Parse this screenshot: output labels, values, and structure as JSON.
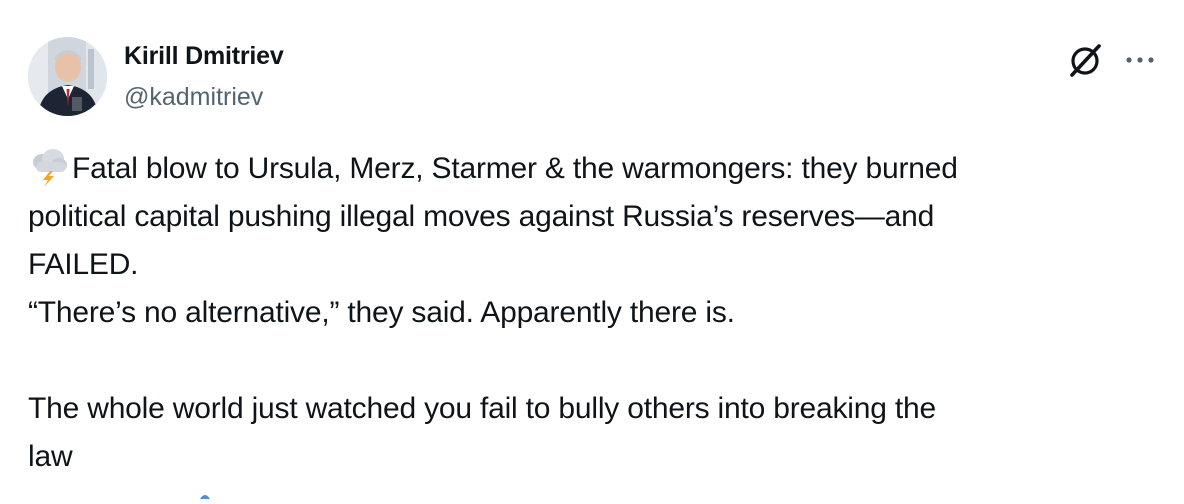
{
  "author": {
    "name": "Kirill Dmitriev",
    "handle": "@kadmitriev"
  },
  "icons": {
    "avatar": "profile-photo",
    "grok": "grok-slash-icon",
    "more": "more-dots-icon",
    "emoji": "cloud-with-lightning-emoji"
  },
  "tweet": {
    "line1": "Fatal blow to Ursula, Merz, Starmer & the warmongers: they burned",
    "line2": "political capital pushing illegal moves against Russia’s reserves—and",
    "line3": "FAILED.",
    "line4": "“There’s no alternative,” they said. Apparently there is.",
    "line5": "The whole world just watched you fail to bully others into breaking the",
    "line6": "law"
  },
  "colors": {
    "text": "#0f1419",
    "secondary": "#536471",
    "background": "#ffffff"
  }
}
